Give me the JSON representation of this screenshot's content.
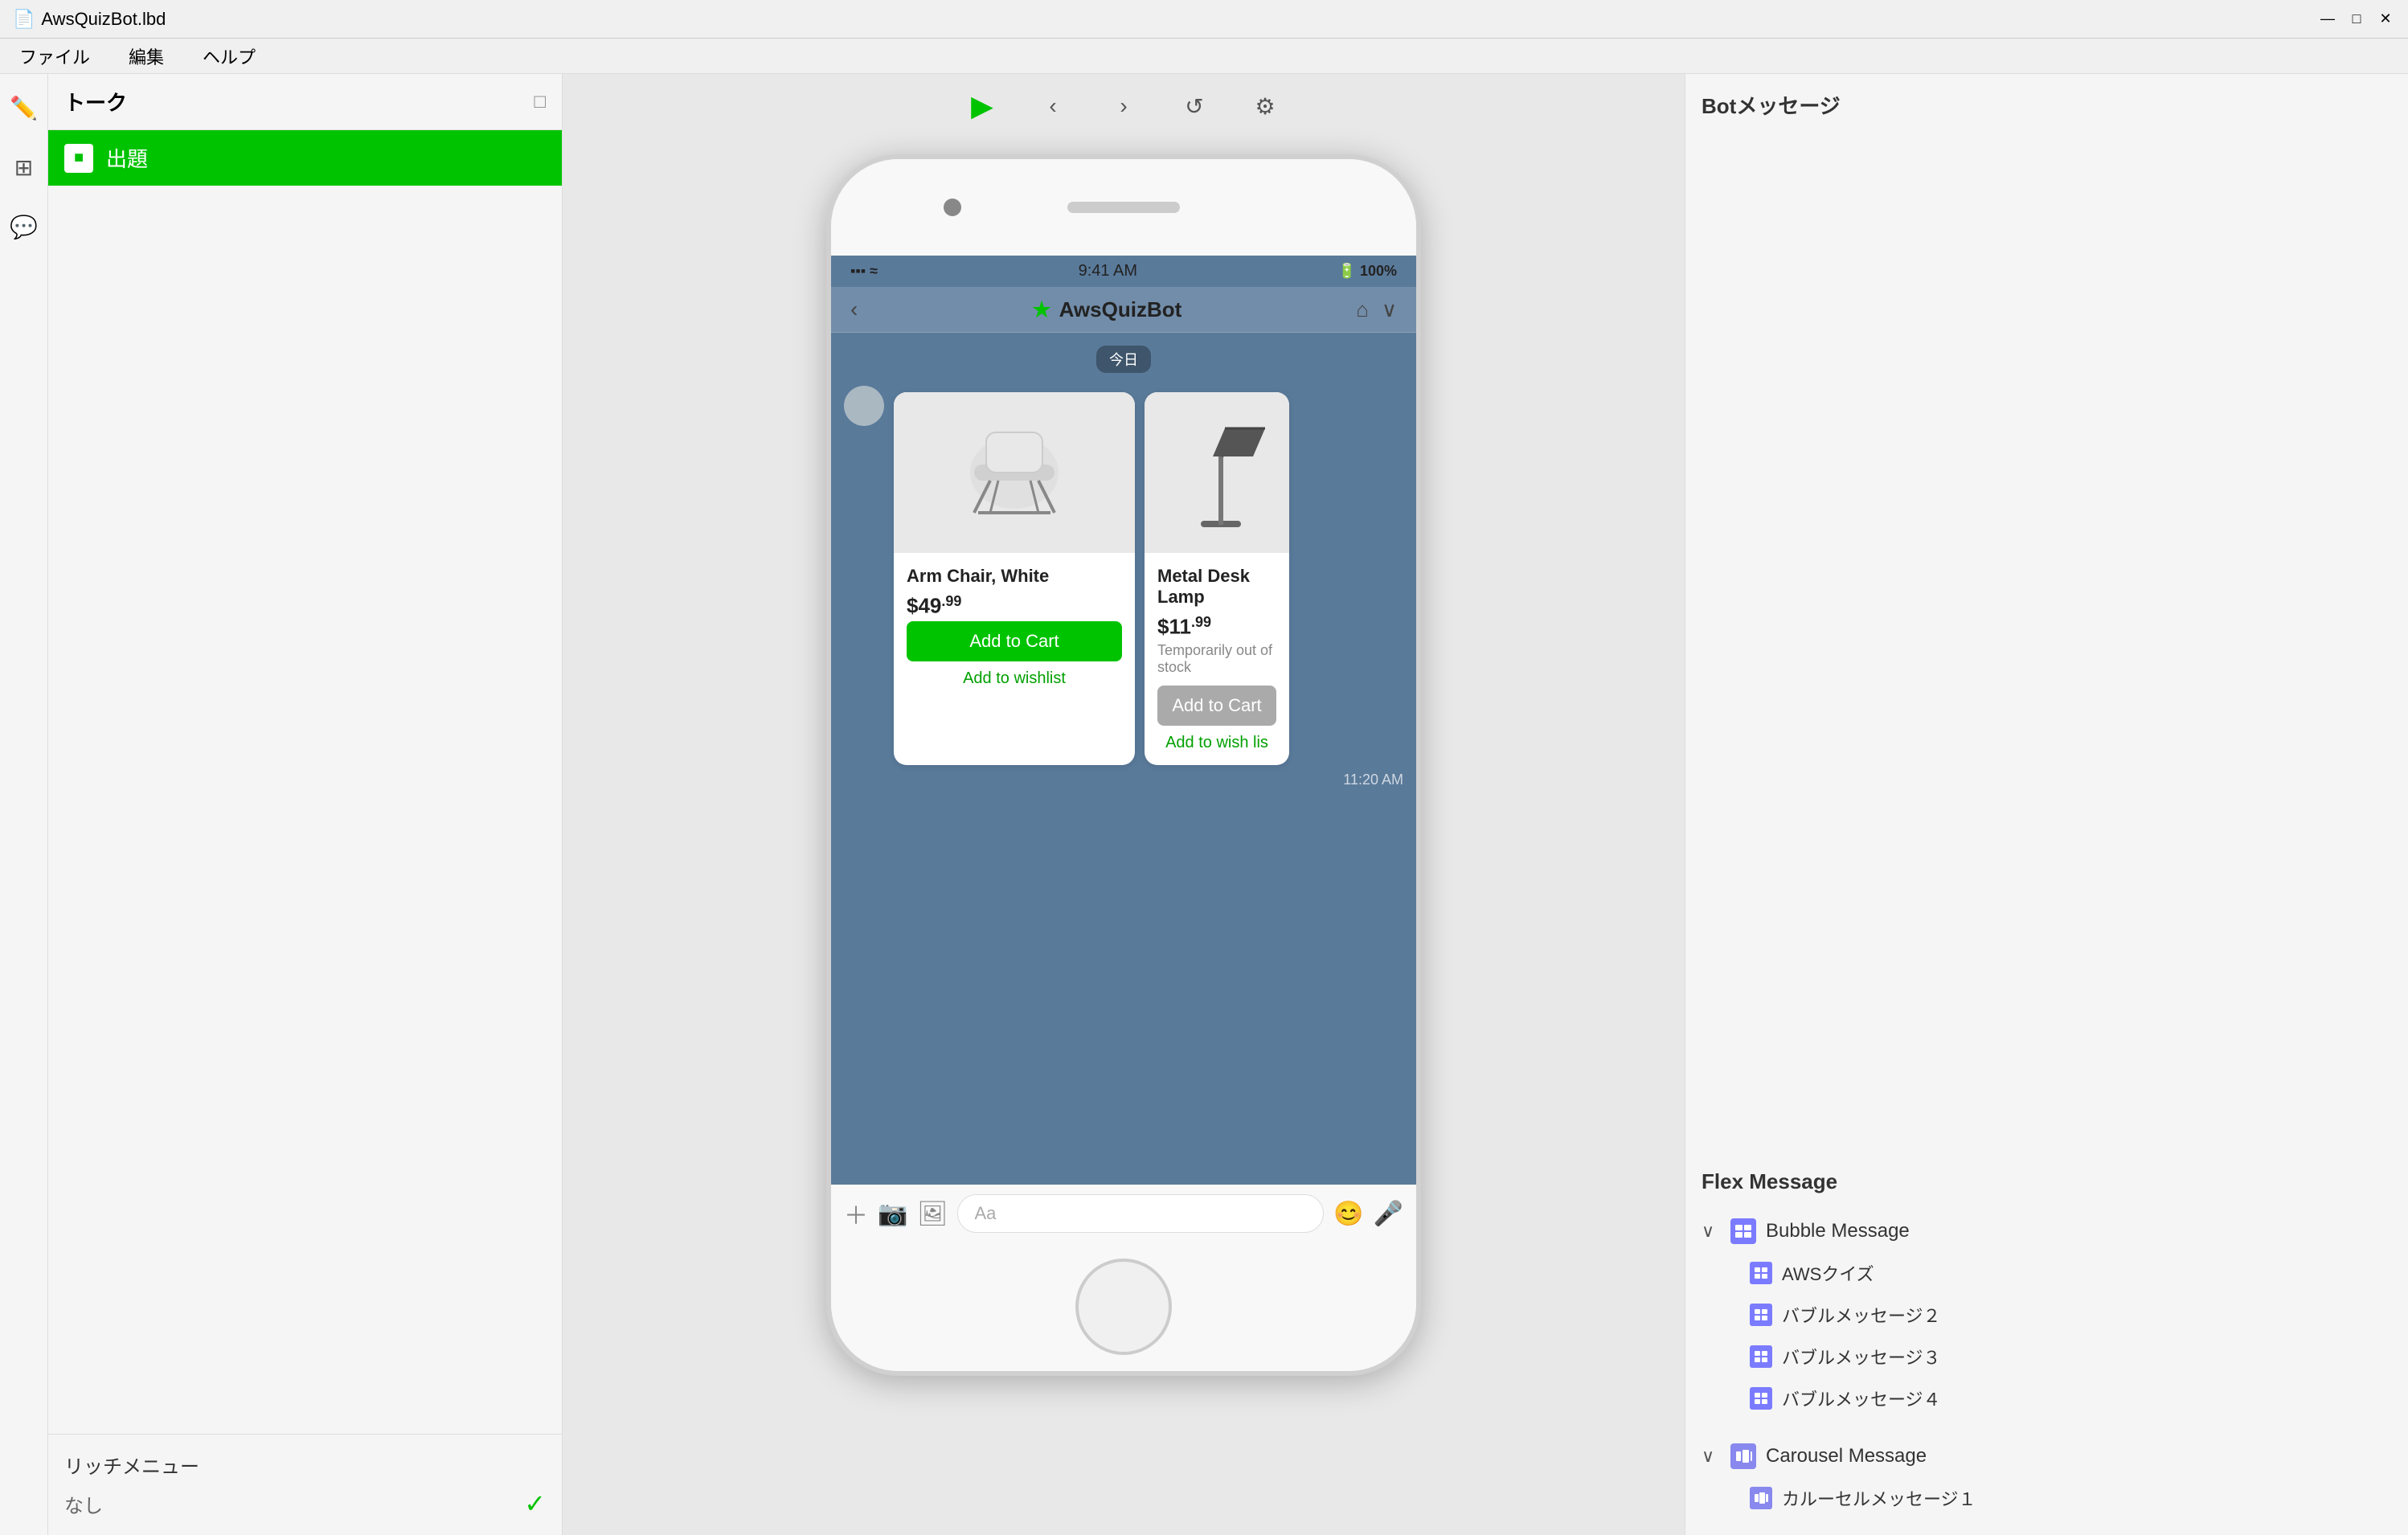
{
  "titleBar": {
    "title": "AwsQuizBot.lbd",
    "minimize": "—",
    "restore": "□",
    "close": "✕"
  },
  "menuBar": {
    "items": [
      "ファイル",
      "編集",
      "ヘルプ"
    ]
  },
  "leftPanel": {
    "title": "トーク",
    "talkItem": "出題",
    "richMenuTitle": "リッチメニュー",
    "richMenuValue": "なし"
  },
  "toolbar": {
    "play": "▶",
    "back": "‹",
    "forward": "›",
    "refresh": "↺",
    "settings": "⚙"
  },
  "phone": {
    "statusBar": {
      "signal": "▪▪▪ ≈",
      "time": "9:41 AM",
      "battery": "🔋 100%"
    },
    "chatHeader": {
      "back": "‹",
      "botName": "AwsQuizBot",
      "home": "⌂",
      "chevron": "∨"
    },
    "dateBadge": "今日",
    "products": [
      {
        "name": "Arm Chair, White",
        "priceMain": "$49",
        "priceCents": ".99",
        "stock": "",
        "addToCart": "Add to Cart",
        "wishlist": "Add to wishlist"
      },
      {
        "name": "Metal Desk Lamp",
        "priceMain": "$11",
        "priceCents": ".99",
        "stock": "Temporarily out of stock",
        "addToCart": "Add to Cart",
        "wishlist": "Add to wish lis"
      }
    ],
    "timestamp": "11:20 AM",
    "inputPlaceholder": "Aa"
  },
  "rightPanel": {
    "title": "Botメッセージ",
    "flexMessage": {
      "title": "Flex Message",
      "bubbleSection": {
        "label": "Bubble Message",
        "items": [
          "AWSクイズ",
          "バブルメッセージ２",
          "バブルメッセージ３",
          "バブルメッセージ４"
        ]
      },
      "carouselSection": {
        "label": "Carousel Message",
        "items": [
          "カルーセルメッセージ１"
        ]
      }
    }
  }
}
